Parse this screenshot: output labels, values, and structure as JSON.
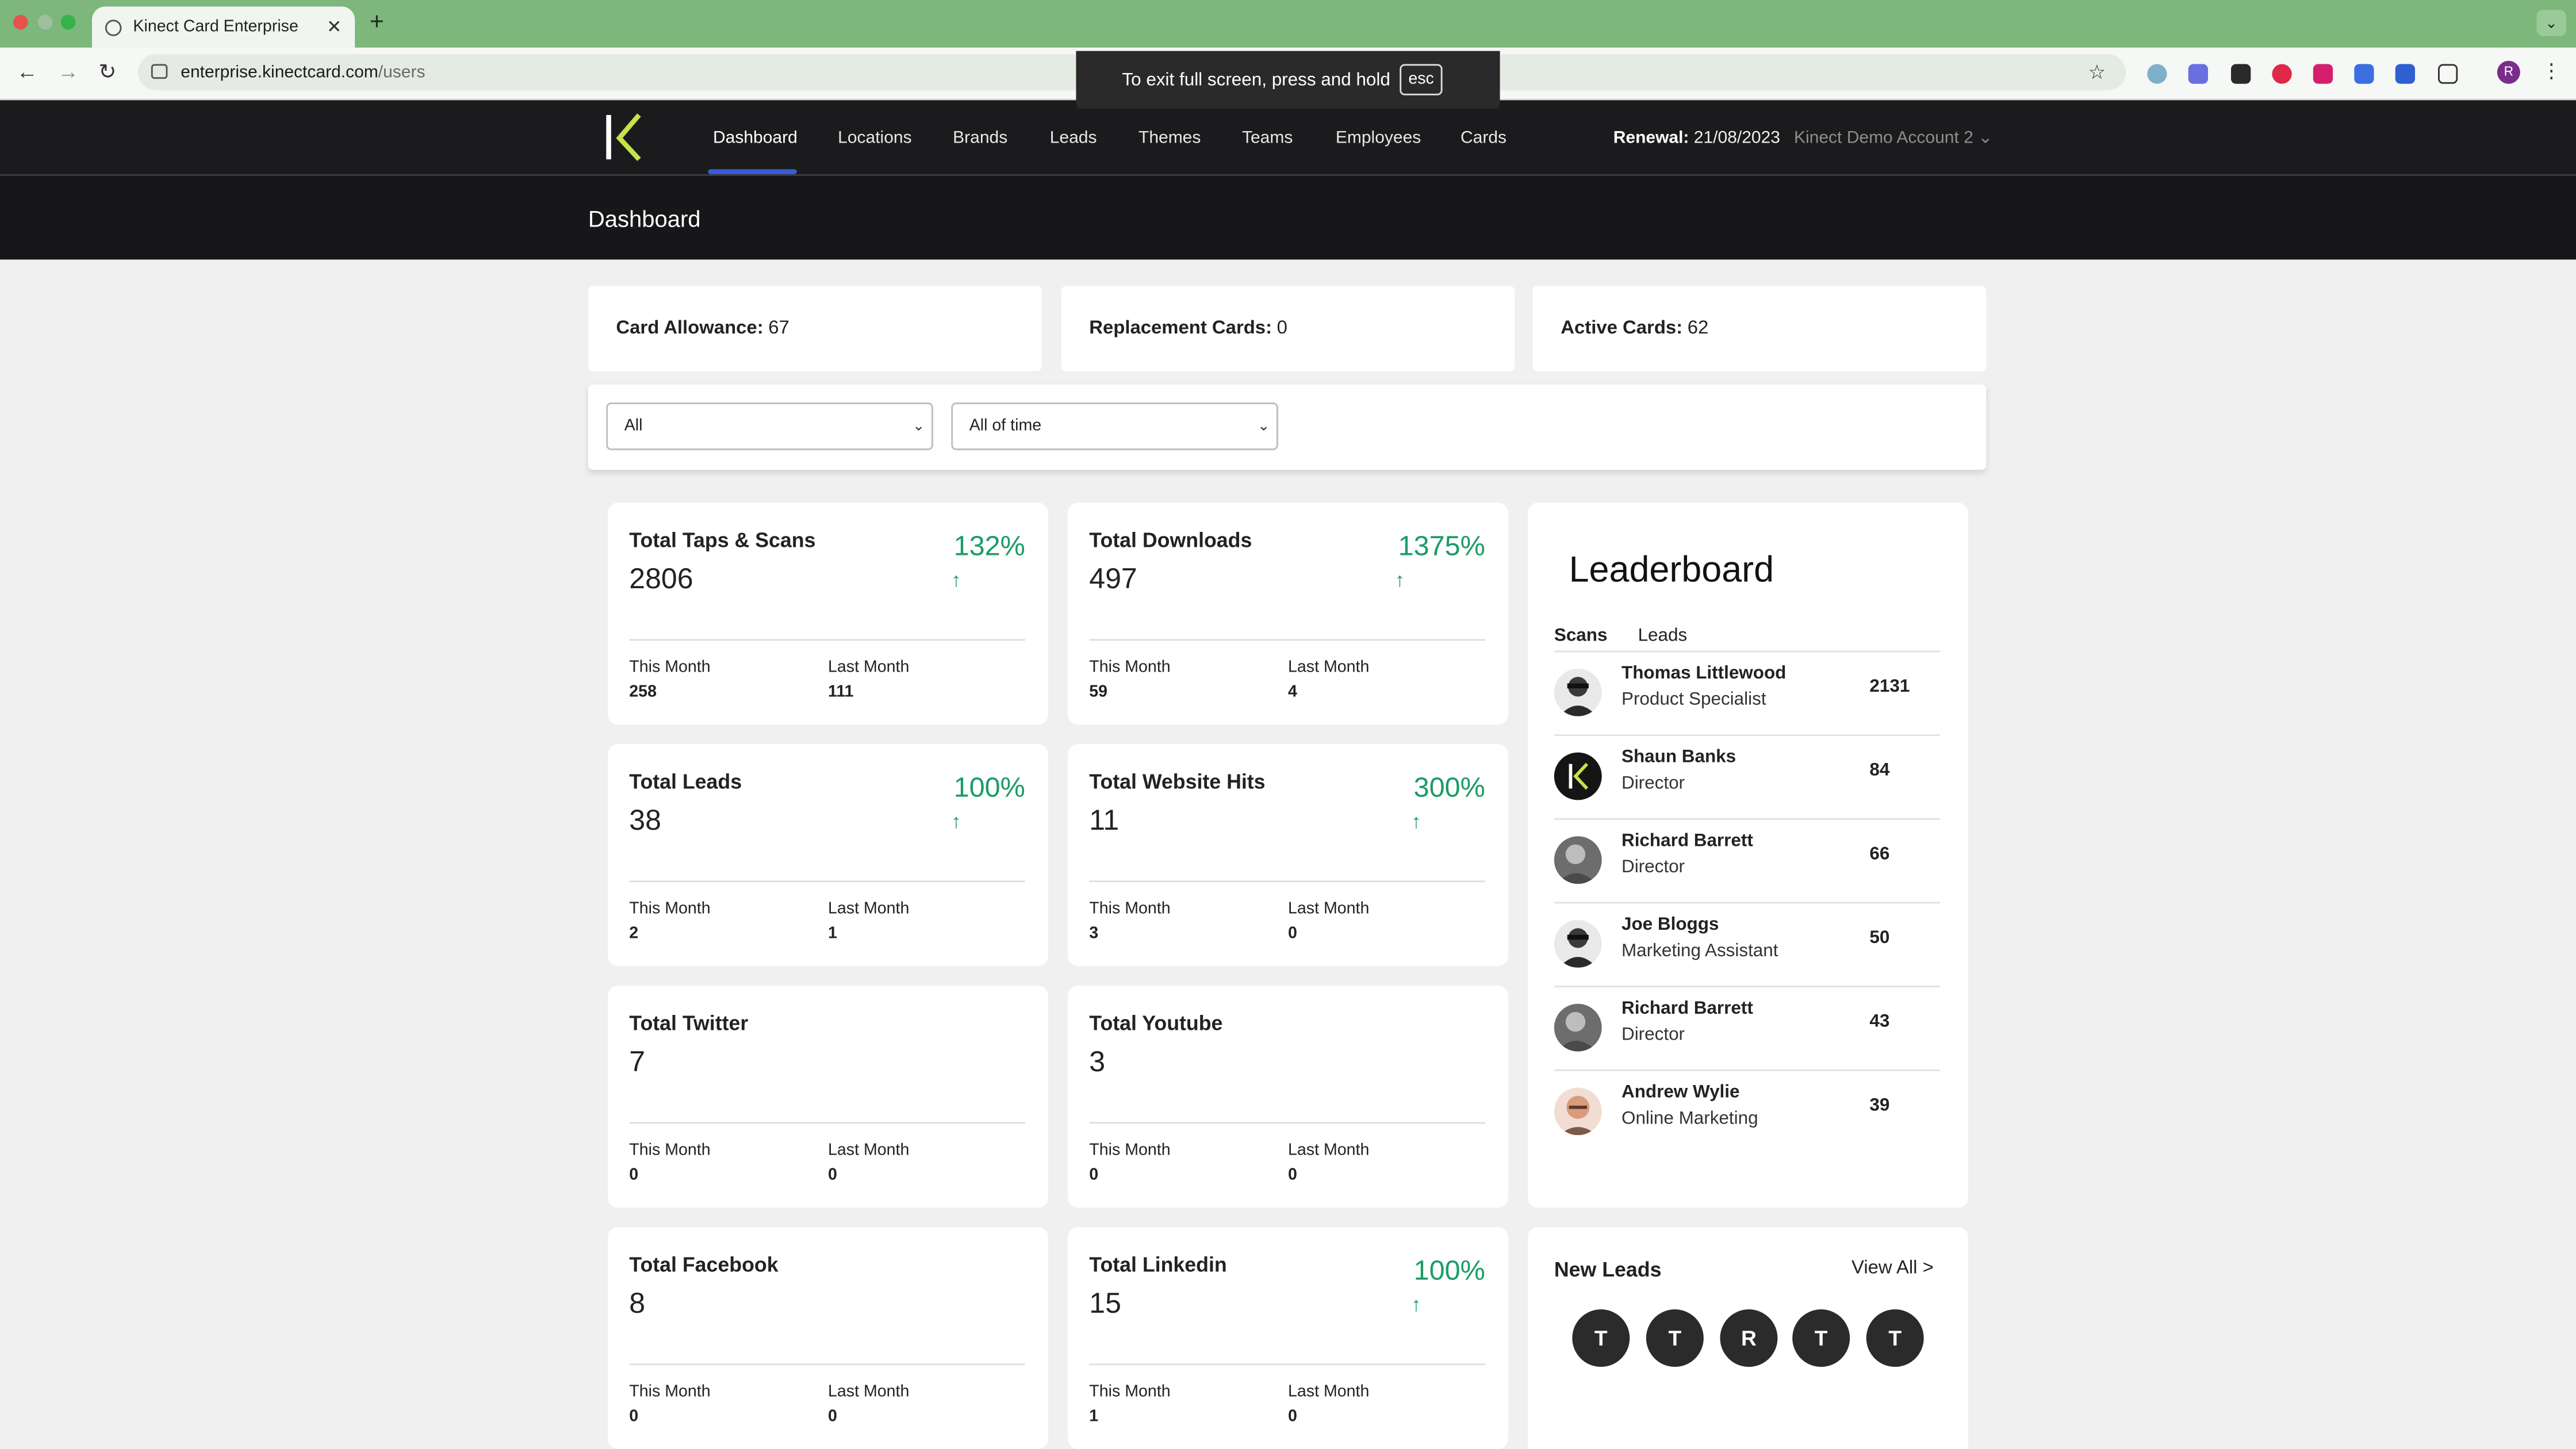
{
  "browser": {
    "tab_title": "Kinect Card Enterprise",
    "close_glyph": "✕",
    "newtab_glyph": "+",
    "tabmenu_glyph": "⌄",
    "url_host": "enterprise.kinectcard.com",
    "url_path": "/users",
    "fullscreen_msg": "To exit full screen, press and hold",
    "fullscreen_key": "esc",
    "profile_initial": "R",
    "back_glyph": "←",
    "forward_glyph": "→",
    "reload_glyph": "↻",
    "star_glyph": "☆",
    "kebab_glyph": "⋮"
  },
  "nav": {
    "items": [
      "Dashboard",
      "Locations",
      "Brands",
      "Leads",
      "Themes",
      "Teams",
      "Employees",
      "Cards"
    ],
    "renewal_label": "Renewal:",
    "renewal_value": "21/08/2023",
    "account": "Kinect Demo Account 2",
    "account_caret": "⌄"
  },
  "page_title": "Dashboard",
  "summary": [
    {
      "label": "Card Allowance:",
      "value": "67"
    },
    {
      "label": "Replacement Cards:",
      "value": "0"
    },
    {
      "label": "Active Cards:",
      "value": "62"
    }
  ],
  "filters": {
    "group": "All",
    "period": "All of time",
    "caret": "⌄"
  },
  "cards": [
    {
      "title": "Total Taps & Scans",
      "value": "2806",
      "pct": "132%",
      "arrow": "↑",
      "this_label": "This Month",
      "this_value": "258",
      "last_label": "Last Month",
      "last_value": "111"
    },
    {
      "title": "Total Downloads",
      "value": "497",
      "pct": "1375%",
      "arrow": "↑",
      "this_label": "This Month",
      "this_value": "59",
      "last_label": "Last Month",
      "last_value": "4"
    },
    {
      "title": "Total Leads",
      "value": "38",
      "pct": "100%",
      "arrow": "↑",
      "this_label": "This Month",
      "this_value": "2",
      "last_label": "Last Month",
      "last_value": "1"
    },
    {
      "title": "Total Website Hits",
      "value": "11",
      "pct": "300%",
      "arrow": "↑",
      "this_label": "This Month",
      "this_value": "3",
      "last_label": "Last Month",
      "last_value": "0"
    },
    {
      "title": "Total Twitter",
      "value": "7",
      "pct": "",
      "arrow": "",
      "this_label": "This Month",
      "this_value": "0",
      "last_label": "Last Month",
      "last_value": "0"
    },
    {
      "title": "Total Youtube",
      "value": "3",
      "pct": "",
      "arrow": "",
      "this_label": "This Month",
      "this_value": "0",
      "last_label": "Last Month",
      "last_value": "0"
    },
    {
      "title": "Total Facebook",
      "value": "8",
      "pct": "",
      "arrow": "",
      "this_label": "This Month",
      "this_value": "0",
      "last_label": "Last Month",
      "last_value": "0"
    },
    {
      "title": "Total Linkedin",
      "value": "15",
      "pct": "100%",
      "arrow": "↑",
      "this_label": "This Month",
      "this_value": "1",
      "last_label": "Last Month",
      "last_value": "0"
    }
  ],
  "leaderboard": {
    "title": "Leaderboard",
    "tabs": [
      "Scans",
      "Leads"
    ],
    "rows": [
      {
        "name": "Thomas Littlewood",
        "role": "Product Specialist",
        "score": "2131"
      },
      {
        "name": "Shaun Banks",
        "role": "Director",
        "score": "84"
      },
      {
        "name": "Richard Barrett",
        "role": "Director",
        "score": "66"
      },
      {
        "name": "Joe Bloggs",
        "role": "Marketing Assistant",
        "score": "50"
      },
      {
        "name": "Richard Barrett",
        "role": "Director",
        "score": "43"
      },
      {
        "name": "Andrew Wylie",
        "role": "Online Marketing",
        "score": "39"
      }
    ]
  },
  "new_leads": {
    "title": "New Leads",
    "view_all": "View All >",
    "initials": [
      "T",
      "T",
      "R",
      "T",
      "T"
    ]
  },
  "colors": {
    "browser_frame": "#7db77b",
    "nav_bg": "#1b1b1d",
    "accent_green": "#1c9b67",
    "active_underline": "#3a5bd9",
    "logo_green": "#c5e34a"
  }
}
